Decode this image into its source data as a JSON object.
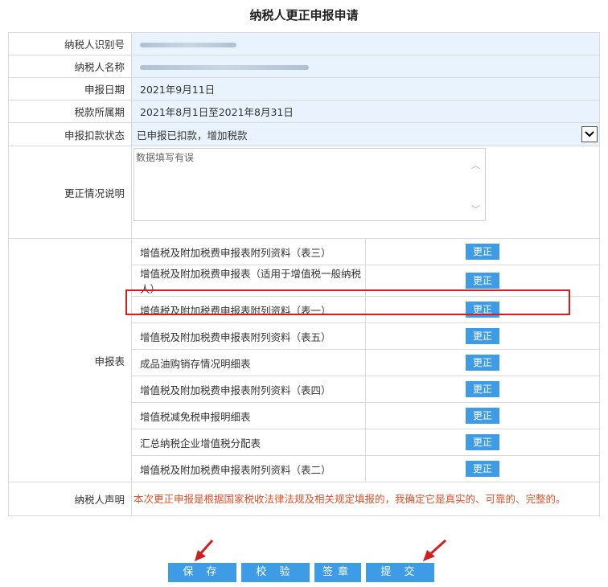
{
  "page": {
    "title": "纳税人更正申报申请"
  },
  "form": {
    "taxpayer_id_label": "纳税人识别号",
    "taxpayer_name_label": "纳税人名称",
    "declare_date_label": "申报日期",
    "declare_date_value": "2021年9月11日",
    "tax_period_label": "税款所属期",
    "tax_period_value": "2021年8月1日至2021年8月31日",
    "status_label": "申报扣款状态",
    "status_value": "已申报已扣款，增加税款",
    "correction_label": "更正情况说明",
    "correction_value": "数据填写有误",
    "reports_label": "申报表",
    "declaration_label": "纳税人声明",
    "declaration_text": "本次更正申报是根据国家税收法律法规及相关规定填报的，我确定它是真实的、可靠的、完整的。"
  },
  "reports": [
    {
      "name": "增值税及附加税费申报表附列资料（表三）",
      "action": "更正"
    },
    {
      "name": "增值税及附加税费申报表（适用于增值税一般纳税人）",
      "action": "更正"
    },
    {
      "name": "增值税及附加税费申报表附列资料（表一）",
      "action": "更正"
    },
    {
      "name": "增值税及附加税费申报表附列资料（表五）",
      "action": "更正"
    },
    {
      "name": "成品油购销存情况明细表",
      "action": "更正"
    },
    {
      "name": "增值税及附加税费申报表附列资料（表四）",
      "action": "更正"
    },
    {
      "name": "增值税减免税申报明细表",
      "action": "更正"
    },
    {
      "name": "汇总纳税企业增值税分配表",
      "action": "更正"
    },
    {
      "name": "增值税及附加税费申报表附列资料（表二）",
      "action": "更正"
    }
  ],
  "buttons": {
    "save": "保 存",
    "verify": "校 验",
    "sign": "签章",
    "submit": "提 交"
  },
  "colors": {
    "accent": "#3e9be6",
    "highlight": "#d21e1e",
    "declaration": "#e0502a"
  }
}
